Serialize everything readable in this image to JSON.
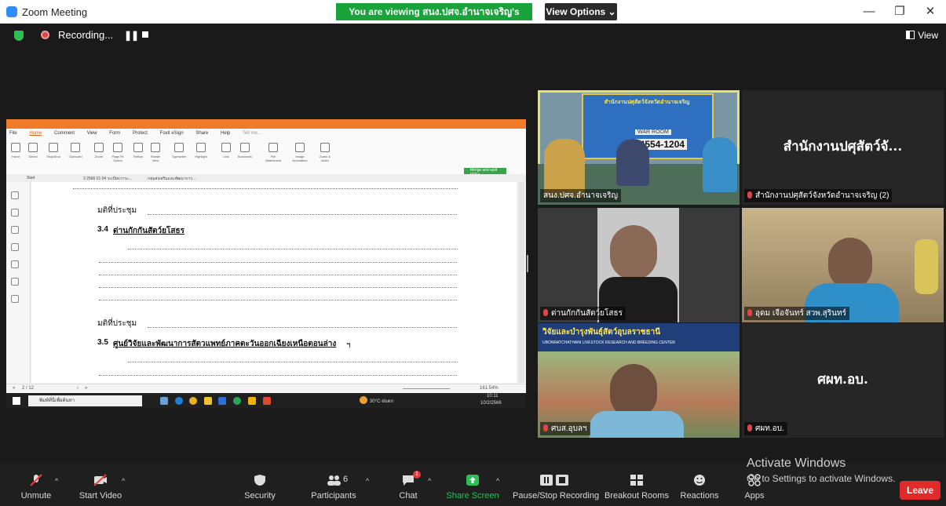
{
  "window": {
    "title": "Zoom Meeting",
    "minimize": "—",
    "restore": "❐",
    "close": "✕"
  },
  "banner": {
    "viewing": "You are viewing สนง.ปศจ.อำนาจเจริญ's screen",
    "view_options": "View Options ⌄"
  },
  "recording": {
    "status": "Recording..."
  },
  "view_button": {
    "label": "View"
  },
  "shared_screen": {
    "menu": [
      "File",
      "Home",
      "Comment",
      "View",
      "Form",
      "Protect",
      "Foxit eSign",
      "Share",
      "Help",
      "Tell me..."
    ],
    "tools": [
      "Hand",
      "Select",
      "SnapShot",
      "Clipboard",
      "Zoom",
      "Page Fit Option",
      "Reflow",
      "Rotate View",
      "Typewriter",
      "Highlight",
      "Link",
      "Bookmark",
      "File Attachment",
      "Image Annotation",
      "Audio & Video"
    ],
    "merge_button": "Merge and split PDFs",
    "tabs": [
      "Start",
      "3 2566 01 04 ระเบียบวาระ...",
      "กลุ่มส่งเสริมและพัฒนาการ..."
    ],
    "doc": {
      "line1": "มติที่ประชุม",
      "heading1": "3.4",
      "heading1_text": "ด่านกักกันสัตว์ยโสธร",
      "line2": "มติที่ประชุม",
      "heading2": "3.5",
      "heading2_text": "ศูนย์วิจัยและพัฒนาการสัตวแพทย์ภาคตะวันออกเฉียงเหนือตอนล่าง",
      "suffix": "ฯ"
    },
    "status": {
      "page": "2 / 12",
      "zoom": "161.54%"
    },
    "taskbar": {
      "search": "พิมพ์ที่นี่เพื่อค้นหา",
      "weather": "30°C ฝนตก",
      "time": "10:11",
      "date": "10/2/2566"
    }
  },
  "participants": [
    {
      "name": "สนง.ปศจ.อำนาจเจริญ",
      "active": true
    },
    {
      "name": "สำนักงานปศุสัตว์จังหวัดอำนาจเจริญ (2)",
      "big": "สำนักงานปศุสัตว์จั..."
    },
    {
      "name": "ด่านกักกันสัตว์ยโสธร"
    },
    {
      "name": "อุดม เจือจันทร์ สวพ.สุรินทร์"
    },
    {
      "name": "ศบส.อุบลฯ"
    },
    {
      "name": "ศผท.อบ.",
      "big": "ศผท.อบ."
    }
  ],
  "room_sign": {
    "line1": "สำนักงานปศุสัตว์จังหวัดอำนาจเจริญ",
    "phone": "0-4554-1204",
    "brand": "WAR ROOM"
  },
  "farm_sign": {
    "line1": "วิจัยและบำรุงพันธุ์สัตว์อุบลราชธานี",
    "line2": "UBONRATCHATHANI LIVESTOCK RESEARCH AND BREEDING CENTER"
  },
  "toolbar": {
    "unmute": "Unmute",
    "start_video": "Start Video",
    "security": "Security",
    "participants": "Participants",
    "participants_count": "6",
    "chat": "Chat",
    "chat_badge": "1",
    "share_screen": "Share Screen",
    "pause_recording": "Pause/Stop Recording",
    "breakout": "Breakout Rooms",
    "reactions": "Reactions",
    "apps": "Apps",
    "leave": "Leave"
  },
  "activate_windows": {
    "title": "Activate Windows",
    "subtitle": "Go to Settings to activate Windows."
  },
  "colors": {
    "share_green": "#1aa33b",
    "leave_red": "#e02b2b",
    "active_outline": "#e6e36a",
    "foxit_orange": "#f07a28"
  }
}
